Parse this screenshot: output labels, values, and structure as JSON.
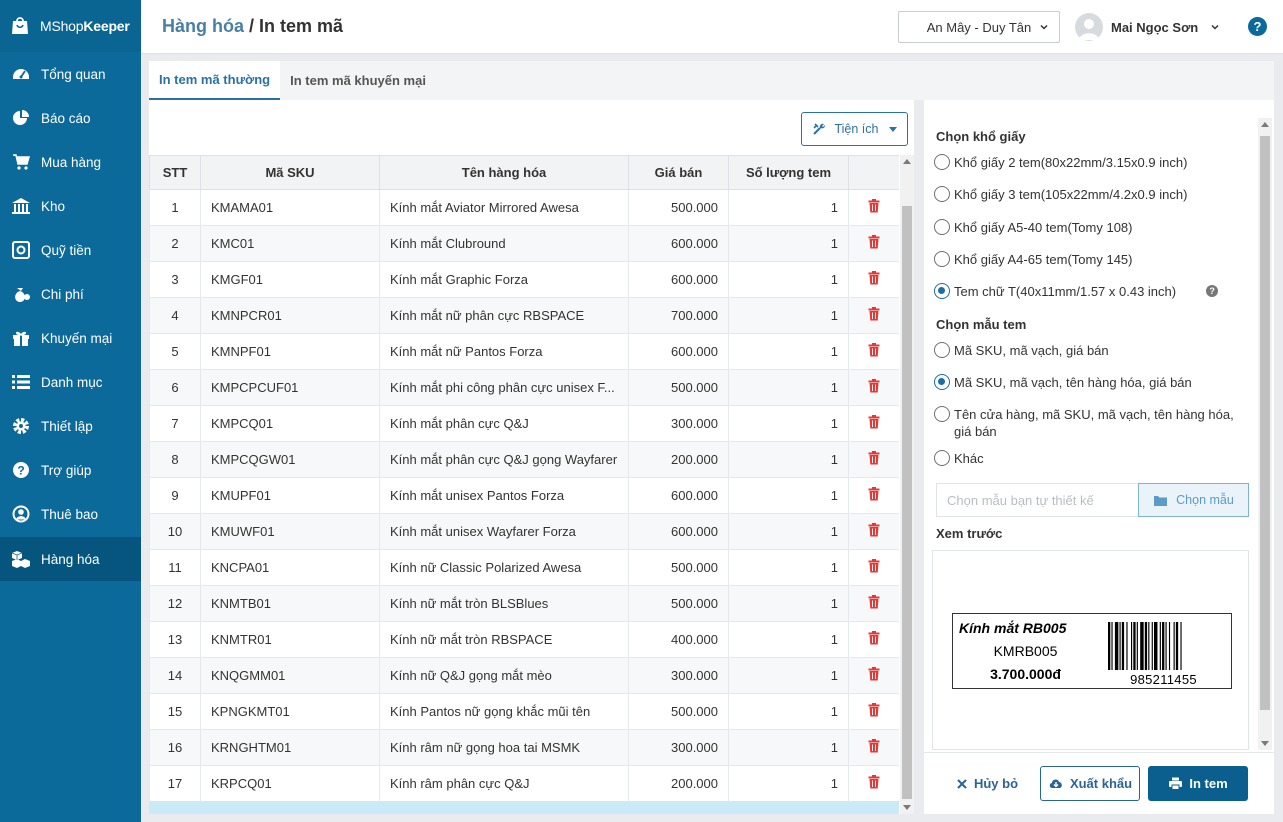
{
  "app": {
    "brand_light": "MShop",
    "brand_bold": "Keeper"
  },
  "sidebar": {
    "items": [
      {
        "label": "Tổng quan",
        "icon": "dashboard-icon"
      },
      {
        "label": "Báo cáo",
        "icon": "pie-chart-icon"
      },
      {
        "label": "Mua hàng",
        "icon": "cart-icon"
      },
      {
        "label": "Kho",
        "icon": "warehouse-icon"
      },
      {
        "label": "Quỹ tiền",
        "icon": "safe-icon"
      },
      {
        "label": "Chi phí",
        "icon": "money-bag-icon"
      },
      {
        "label": "Khuyến mại",
        "icon": "gift-icon"
      },
      {
        "label": "Danh mục",
        "icon": "list-icon"
      },
      {
        "label": "Thiết lập",
        "icon": "gear-icon"
      },
      {
        "label": "Trợ giúp",
        "icon": "help-icon"
      },
      {
        "label": "Thuê bao",
        "icon": "user-icon"
      },
      {
        "label": "Hàng hóa",
        "icon": "boxes-icon",
        "active": true
      }
    ]
  },
  "header": {
    "crumb_parent": "Hàng hóa",
    "crumb_sep": " / ",
    "crumb_current": "In tem mã",
    "store": "An Mây - Duy Tân",
    "user": "Mai Ngọc Sơn",
    "help": "?"
  },
  "tabs": [
    {
      "label": "In tem mã thường",
      "active": true
    },
    {
      "label": "In tem mã khuyến mại",
      "active": false
    }
  ],
  "toolbar": {
    "utilities_label": "Tiện ích"
  },
  "table": {
    "headers": [
      "STT",
      "Mã SKU",
      "Tên hàng hóa",
      "Giá bán",
      "Số lượng tem",
      ""
    ],
    "rows": [
      {
        "stt": "1",
        "sku": "KMAMA01",
        "name": "Kính mắt Aviator Mirrored Awesa",
        "price": "500.000",
        "qty": "1"
      },
      {
        "stt": "2",
        "sku": "KMC01",
        "name": "Kính mắt Clubround",
        "price": "600.000",
        "qty": "1"
      },
      {
        "stt": "3",
        "sku": "KMGF01",
        "name": "Kính mắt Graphic Forza",
        "price": "600.000",
        "qty": "1"
      },
      {
        "stt": "4",
        "sku": "KMNPCR01",
        "name": "Kính mắt nữ phân cực RBSPACE",
        "price": "700.000",
        "qty": "1"
      },
      {
        "stt": "5",
        "sku": "KMNPF01",
        "name": "Kính mắt nữ Pantos Forza",
        "price": "600.000",
        "qty": "1"
      },
      {
        "stt": "6",
        "sku": "KMPCPCUF01",
        "name": "Kính mắt phi công phân cực unisex F...",
        "price": "500.000",
        "qty": "1"
      },
      {
        "stt": "7",
        "sku": "KMPCQ01",
        "name": "Kính mắt phân cực Q&J",
        "price": "300.000",
        "qty": "1"
      },
      {
        "stt": "8",
        "sku": "KMPCQGW01",
        "name": "Kính mắt phân cực Q&J gọng Wayfarer",
        "price": "200.000",
        "qty": "1"
      },
      {
        "stt": "9",
        "sku": "KMUPF01",
        "name": "Kính mắt unisex Pantos Forza",
        "price": "600.000",
        "qty": "1"
      },
      {
        "stt": "10",
        "sku": "KMUWF01",
        "name": "Kính mắt unisex Wayfarer Forza",
        "price": "600.000",
        "qty": "1"
      },
      {
        "stt": "11",
        "sku": "KNCPA01",
        "name": "Kính nữ Classic Polarized Awesa",
        "price": "500.000",
        "qty": "1"
      },
      {
        "stt": "12",
        "sku": "KNMTB01",
        "name": "Kính nữ mắt tròn BLSBlues",
        "price": "500.000",
        "qty": "1"
      },
      {
        "stt": "13",
        "sku": "KNMTR01",
        "name": "Kính nữ mắt tròn RBSPACE",
        "price": "400.000",
        "qty": "1"
      },
      {
        "stt": "14",
        "sku": "KNQGMM01",
        "name": "Kính nữ Q&J gọng mắt mèo",
        "price": "300.000",
        "qty": "1"
      },
      {
        "stt": "15",
        "sku": "KPNGKMT01",
        "name": "Kính Pantos nữ gọng khắc mũi tên",
        "price": "500.000",
        "qty": "1"
      },
      {
        "stt": "16",
        "sku": "KRNGHTM01",
        "name": "Kính râm nữ gọng hoa tai MSMK",
        "price": "300.000",
        "qty": "1"
      },
      {
        "stt": "17",
        "sku": "KRPCQ01",
        "name": "Kính râm phân cực Q&J",
        "price": "200.000",
        "qty": "1"
      }
    ]
  },
  "paper": {
    "title": "Chọn khổ giấy",
    "options": [
      {
        "label": "Khổ giấy 2 tem(80x22mm/3.15x0.9 inch)",
        "selected": false
      },
      {
        "label": "Khổ giấy 3 tem(105x22mm/4.2x0.9 inch)",
        "selected": false
      },
      {
        "label": "Khổ giấy A5-40 tem(Tomy 108)",
        "selected": false
      },
      {
        "label": "Khổ giấy A4-65 tem(Tomy 145)",
        "selected": false
      },
      {
        "label": "Tem chữ T(40x11mm/1.57 x 0.43 inch)",
        "selected": true
      }
    ]
  },
  "template": {
    "title": "Chọn mẫu tem",
    "options": [
      {
        "label": "Mã SKU, mã vạch, giá bán",
        "selected": false
      },
      {
        "label": "Mã SKU, mã vạch, tên hàng hóa, giá bán",
        "selected": true
      },
      {
        "label": "Tên cửa hàng, mã SKU, mã vạch, tên hàng hóa, giá bán",
        "selected": false
      },
      {
        "label": "Khác",
        "selected": false
      }
    ],
    "input_placeholder": "Chọn mẫu bạn tự thiết kế",
    "choose_label": "Chọn mẫu"
  },
  "preview": {
    "title": "Xem trước",
    "product_name": "Kính mắt RB005",
    "sku": "KMRB005",
    "price": "3.700.000đ",
    "barcode": "985211455"
  },
  "footer": {
    "cancel": "Hủy bỏ",
    "export": "Xuất khẩu",
    "print": "In tem"
  },
  "colors": {
    "sidebar": "#0b6a9a",
    "sidebar_active": "#05557e",
    "accent": "#2a72a5",
    "delete": "#e03b3b",
    "primary_button": "#0b5f8e"
  }
}
